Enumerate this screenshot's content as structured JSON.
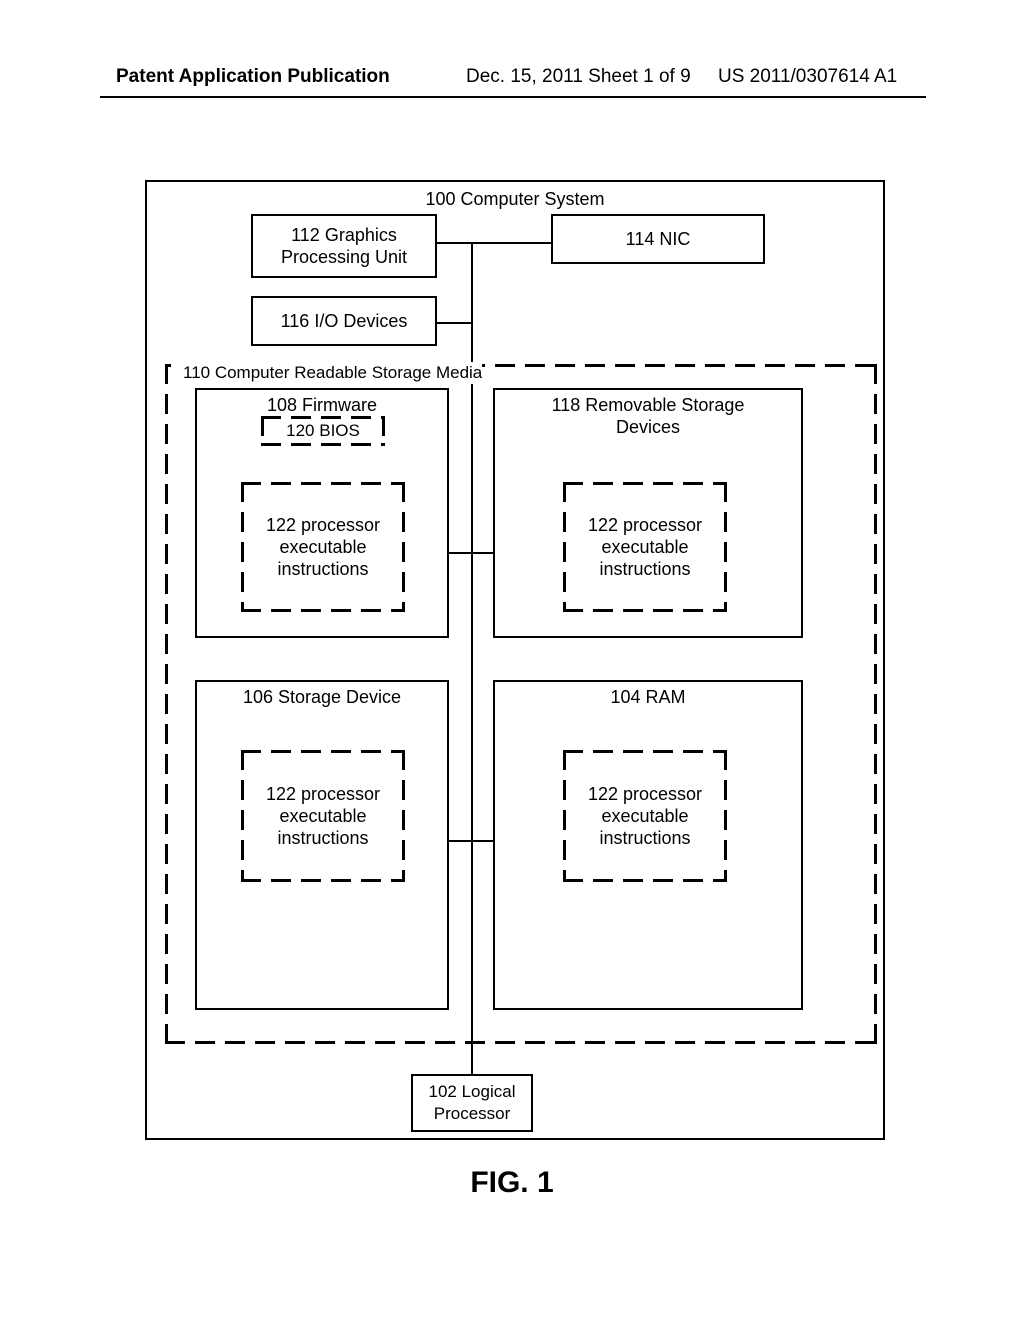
{
  "header": {
    "left": "Patent Application Publication",
    "mid": "Dec. 15, 2011  Sheet 1 of 9",
    "right": "US 2011/0307614 A1"
  },
  "figure_caption": "FIG. 1",
  "diagram": {
    "system_title": "100 Computer System",
    "gpu": "112  Graphics\nProcessing Unit",
    "nic": "114 NIC",
    "io": "116 I/O Devices",
    "media_title": "110 Computer Readable Storage Media",
    "firmware": "108 Firmware",
    "bios": "120 BIOS",
    "removable": "118 Removable Storage\nDevices",
    "storage": "106 Storage Device",
    "ram": "104 RAM",
    "pei": "122 processor\nexecutable\ninstructions",
    "logical_processor": "102 Logical\nProcessor"
  }
}
